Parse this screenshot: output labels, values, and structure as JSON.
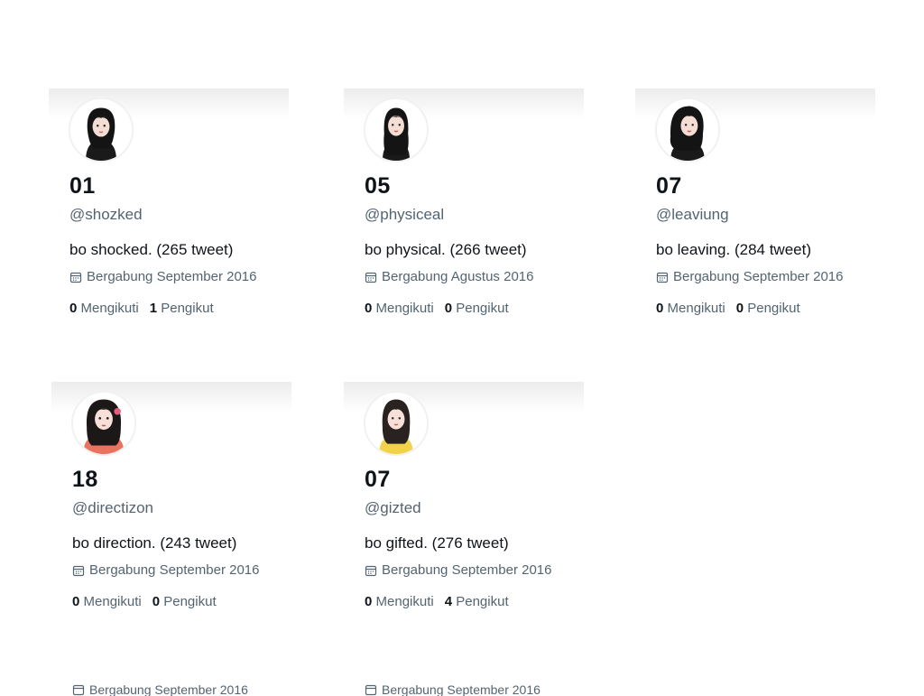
{
  "profiles": [
    {
      "name": "01",
      "handle": "@shozked",
      "bio": "bo shocked. (265 tweet)",
      "joined": "Bergabung September 2016",
      "following_count": "0",
      "following_label": "Mengikuti",
      "followers_count": "1",
      "followers_label": "Pengikut",
      "avatar_accent": "#1a1a1a"
    },
    {
      "name": "05",
      "handle": "@physiceal",
      "bio": "bo physical. (266 tweet)",
      "joined": "Bergabung Agustus 2016",
      "following_count": "0",
      "following_label": "Mengikuti",
      "followers_count": "0",
      "followers_label": "Pengikut",
      "avatar_accent": "#1a1a1a"
    },
    {
      "name": "07",
      "handle": "@leaviung",
      "bio": "bo leaving. (284 tweet)",
      "joined": "Bergabung September 2016",
      "following_count": "0",
      "following_label": "Mengikuti",
      "followers_count": "0",
      "followers_label": "Pengikut",
      "avatar_accent": "#1a1a1a"
    },
    {
      "name": "18",
      "handle": "@directizon",
      "bio": "bo direction. (243 tweet)",
      "joined": "Bergabung September 2016",
      "following_count": "0",
      "following_label": "Mengikuti",
      "followers_count": "0",
      "followers_label": "Pengikut",
      "avatar_accent": "#e8735f"
    },
    {
      "name": "07",
      "handle": "@gizted",
      "bio": "bo gifted. (276 tweet)",
      "joined": "Bergabung September 2016",
      "following_count": "0",
      "following_label": "Mengikuti",
      "followers_count": "4",
      "followers_label": "Pengikut",
      "avatar_accent": "#f2d24a"
    }
  ],
  "cut_off": [
    {
      "text": "Bergabung September 2016"
    },
    {
      "text": "Bergabung September 2016"
    }
  ],
  "colors": {
    "text_primary": "#0f1419",
    "text_secondary": "#536471",
    "banner": "#ececec"
  }
}
